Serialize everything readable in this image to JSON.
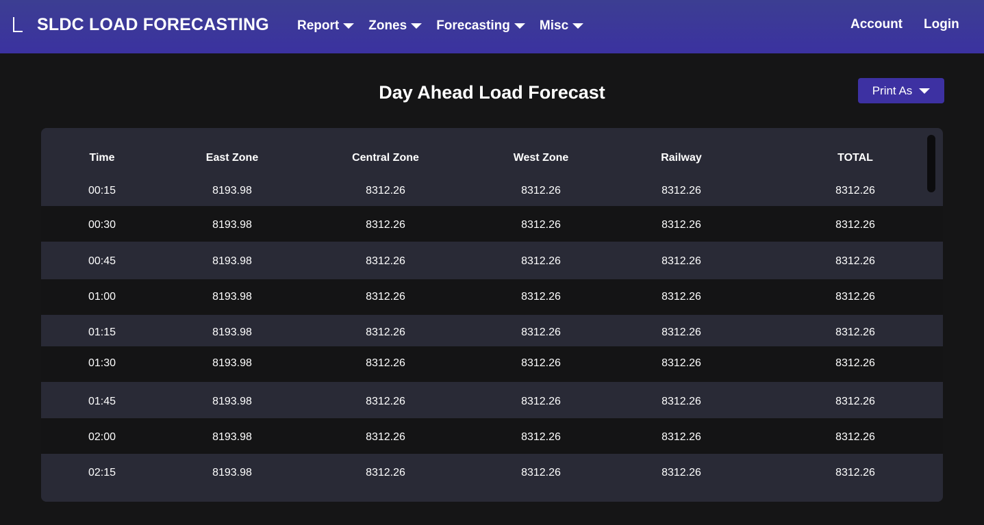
{
  "navbar": {
    "brand": "SLDC LOAD FORECASTING",
    "menu": [
      {
        "label": "Report"
      },
      {
        "label": "Zones"
      },
      {
        "label": "Forecasting"
      },
      {
        "label": "Misc"
      }
    ],
    "account": "Account",
    "login": "Login"
  },
  "page": {
    "title": "Day Ahead Load Forecast",
    "print_label": "Print As"
  },
  "table": {
    "columns": [
      "Time",
      "East Zone",
      "Central Zone",
      "West Zone",
      "Railway",
      "TOTAL"
    ],
    "rows": [
      [
        "00:15",
        "8193.98",
        "8312.26",
        "8312.26",
        "8312.26",
        "8312.26"
      ],
      [
        "00:30",
        "8193.98",
        "8312.26",
        "8312.26",
        "8312.26",
        "8312.26"
      ],
      [
        "00:45",
        "8193.98",
        "8312.26",
        "8312.26",
        "8312.26",
        "8312.26"
      ],
      [
        "01:00",
        "8193.98",
        "8312.26",
        "8312.26",
        "8312.26",
        "8312.26"
      ],
      [
        "01:15",
        "8193.98",
        "8312.26",
        "8312.26",
        "8312.26",
        "8312.26"
      ],
      [
        "01:30",
        "8193.98",
        "8312.26",
        "8312.26",
        "8312.26",
        "8312.26"
      ],
      [
        "01:45",
        "8193.98",
        "8312.26",
        "8312.26",
        "8312.26",
        "8312.26"
      ],
      [
        "02:00",
        "8193.98",
        "8312.26",
        "8312.26",
        "8312.26",
        "8312.26"
      ],
      [
        "02:15",
        "8193.98",
        "8312.26",
        "8312.26",
        "8312.26",
        "8312.26"
      ]
    ]
  },
  "colors": {
    "navbar": "#3b32a0",
    "accent": "#3d31a2",
    "background": "#151516",
    "row_light": "#292a36",
    "row_dark": "#141415"
  }
}
